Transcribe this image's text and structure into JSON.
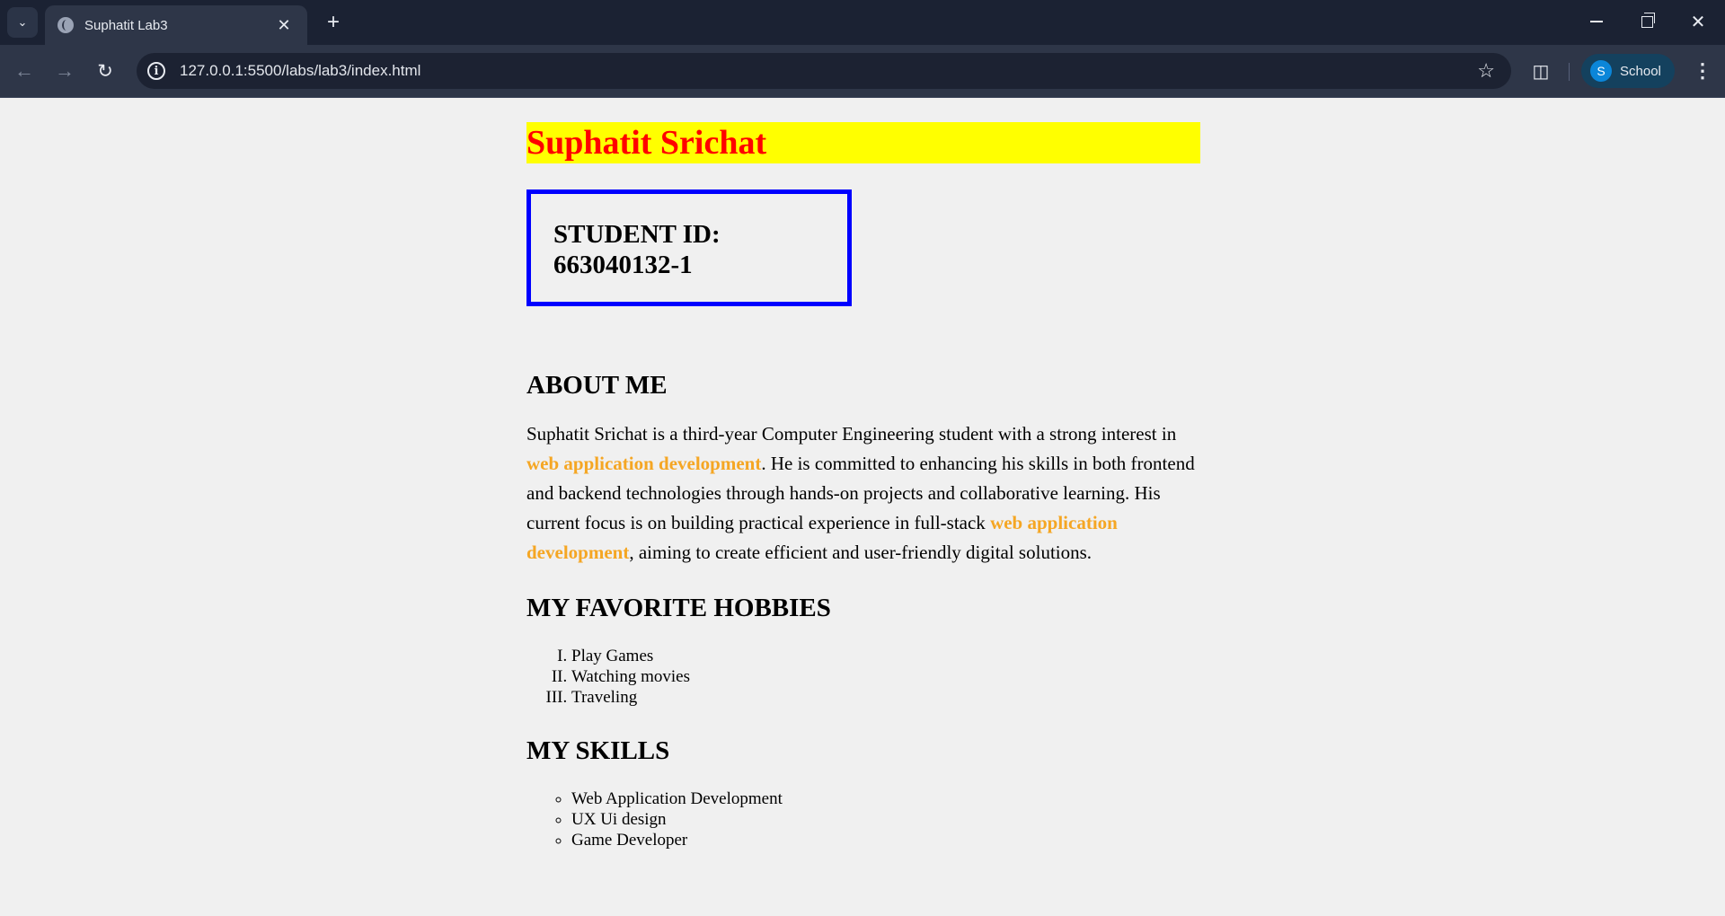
{
  "browser": {
    "tab_title": "Suphatit Lab3",
    "url": "127.0.0.1:5500/labs/lab3/index.html",
    "profile_initial": "S",
    "profile_name": "School"
  },
  "page": {
    "name": "Suphatit Srichat",
    "student_id_label": "STUDENT ID:",
    "student_id_value": "663040132-1",
    "about": {
      "heading": "ABOUT ME",
      "p1": "Suphatit Srichat is a third-year Computer Engineering student with a strong interest in ",
      "hl1": "web application development",
      "p2": ". He is committed to enhancing his skills in both frontend and backend technologies through hands-on projects and collaborative learning. His current focus is on building practical experience in full-stack ",
      "hl2": "web application development",
      "p3": ", aiming to create efficient and user-friendly digital solutions."
    },
    "hobbies": {
      "heading": "MY FAVORITE HOBBIES",
      "items": [
        "Play Games",
        "Watching movies",
        "Traveling"
      ]
    },
    "skills": {
      "heading": "MY SKILLS",
      "items": [
        "Web Application Development",
        "UX Ui design",
        "Game Developer"
      ]
    }
  },
  "colors": {
    "name_text": "#ff0000",
    "name_background": "#ffff00",
    "id_border": "#0000ff",
    "highlight": "#f5a623"
  }
}
